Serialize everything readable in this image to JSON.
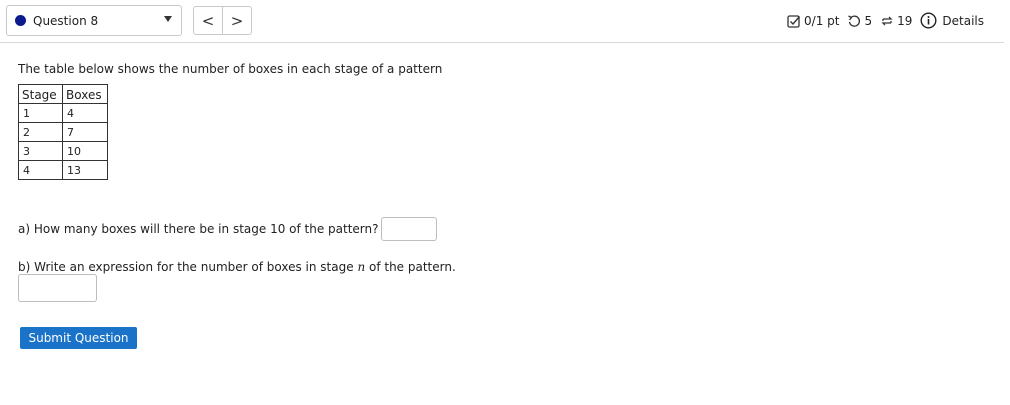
{
  "header": {
    "question_label": "Question 8",
    "prev_label": "<",
    "next_label": ">",
    "score": "0/1 pt",
    "retries": "5",
    "attempts": "19",
    "details": "Details"
  },
  "question": {
    "intro": "The table below shows the number of boxes in each stage of a pattern",
    "table": {
      "headers": [
        "Stage",
        "Boxes"
      ],
      "rows": [
        [
          "1",
          "4"
        ],
        [
          "2",
          "7"
        ],
        [
          "3",
          "10"
        ],
        [
          "4",
          "13"
        ]
      ]
    },
    "part_a": "a) How many boxes will there be in stage 10 of the pattern?",
    "part_a_value": "",
    "part_b_prefix": "b) Write an expression for the number of boxes in stage ",
    "part_b_var": "n",
    "part_b_suffix": " of the pattern.",
    "part_b_value": "",
    "submit_label": "Submit Question"
  },
  "colors": {
    "accent": "#1a73c8",
    "status_dot": "#0b1a8c"
  },
  "icons": {
    "score": "checkbox-icon",
    "retries": "retry-icon",
    "attempts": "refresh-icon",
    "details": "info-icon"
  }
}
